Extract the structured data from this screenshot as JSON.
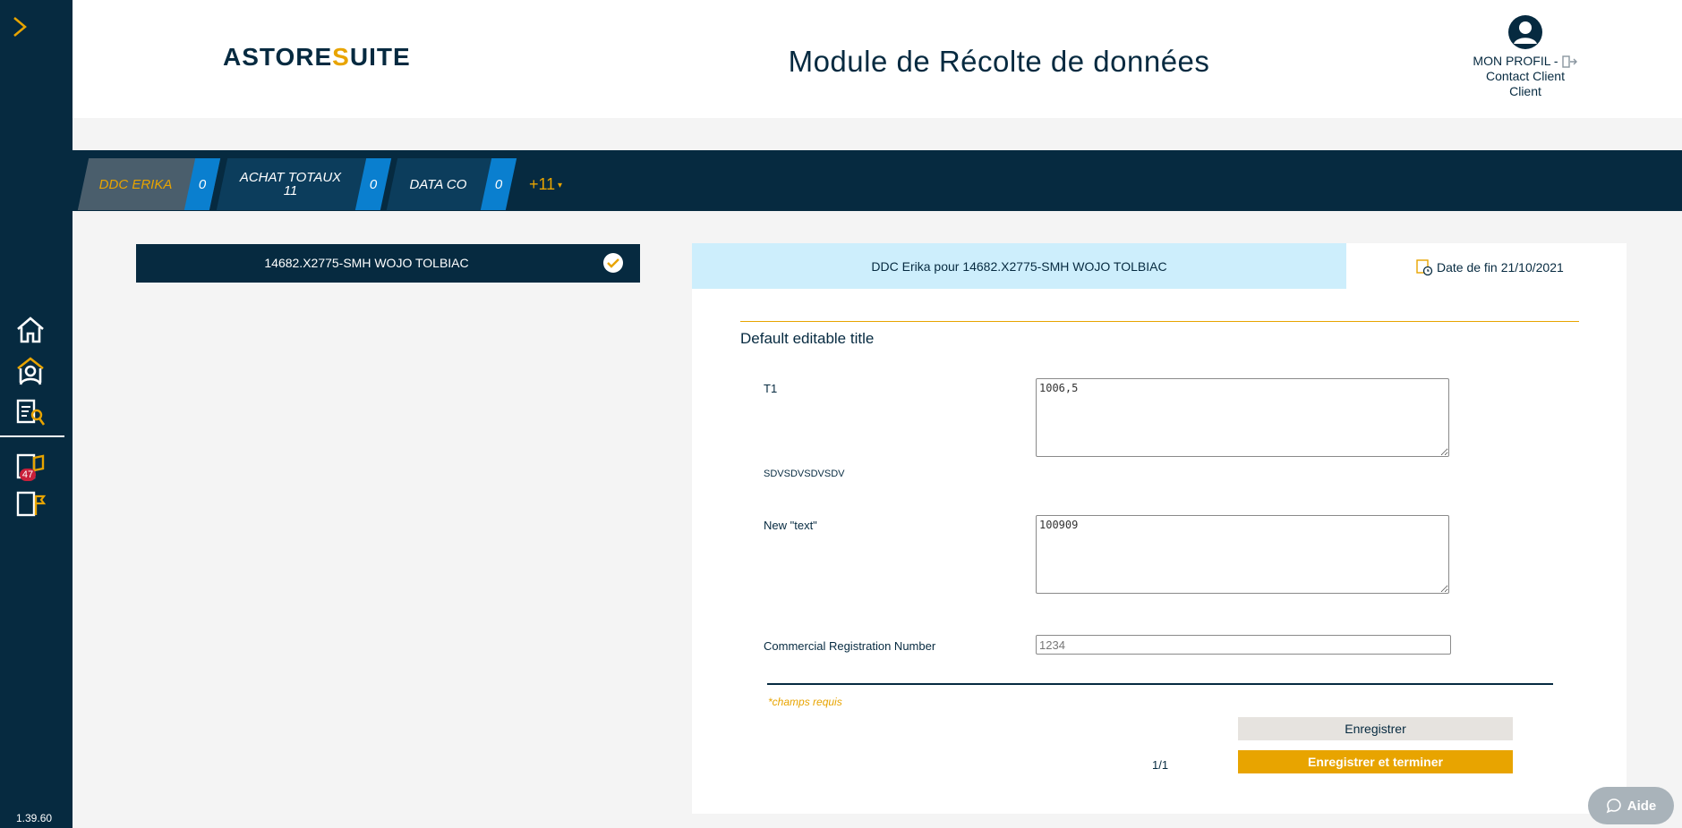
{
  "header": {
    "logo": {
      "part1": "ASTORE",
      "part2": "S",
      "part3": "UITE"
    },
    "title": "Module de Récolte de données",
    "profile": {
      "name": "MON PROFIL -",
      "line2": "Contact Client",
      "line3": "Client"
    }
  },
  "sidebar": {
    "items": [
      {
        "icon": "home-icon"
      },
      {
        "icon": "stores-icon"
      },
      {
        "icon": "checklist-search-icon"
      },
      {
        "icon": "clipboard-flag-icon",
        "badge": "47"
      },
      {
        "icon": "clipboard-sign-icon"
      }
    ],
    "version": "1.39.60"
  },
  "tabs": [
    {
      "label": "DDC ERIKA",
      "count": "0",
      "active": true
    },
    {
      "label_line1": "ACHAT TOTAUX",
      "label_line2": "11",
      "count": "0"
    },
    {
      "label": "DATA CO",
      "count": "0"
    }
  ],
  "more_tabs": "+11",
  "store": {
    "label": "14682.X2775-SMH WOJO TOLBIAC"
  },
  "panel": {
    "heading": "DDC Erika pour 14682.X2775-SMH WOJO TOLBIAC",
    "date_label": "Date de fin",
    "date_value": "21/10/2021",
    "section_title": "Default editable title",
    "fields": [
      {
        "label": "T1",
        "value": "1006,5",
        "help": "SDVSDVSDVSDV"
      },
      {
        "label": "New \"text\"",
        "value": "100909"
      },
      {
        "label": "Commercial Registration Number",
        "value": "1234"
      }
    ],
    "required_note": "*champs requis",
    "save_label": "Enregistrer",
    "finish_label": "Enregistrer et terminer",
    "pager": "1/1"
  },
  "help_label": "Aide",
  "colors": {
    "navy": "#062a40",
    "gold": "#e8a400",
    "blue": "#0a7fcf",
    "light_blue": "#cdeefc"
  }
}
